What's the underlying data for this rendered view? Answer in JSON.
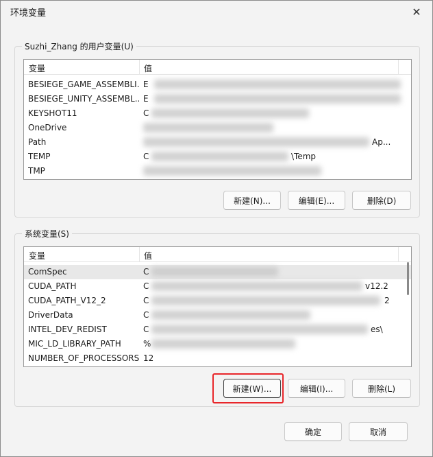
{
  "window": {
    "title": "环境变量",
    "close_symbol": "✕"
  },
  "user_section": {
    "legend": "Suzhi_Zhang 的用户变量(U)",
    "columns": {
      "name": "变量",
      "value": "值"
    },
    "rows": [
      {
        "name": "BESIEGE_GAME_ASSEMBLI...",
        "value_prefix": "E"
      },
      {
        "name": "BESIEGE_UNITY_ASSEMBL...",
        "value_prefix": "E"
      },
      {
        "name": "KEYSHOT11",
        "value_prefix": "C"
      },
      {
        "name": "OneDrive",
        "value_prefix": ""
      },
      {
        "name": "Path",
        "value_prefix": "",
        "value_suffix": "Ap..."
      },
      {
        "name": "TEMP",
        "value_prefix": "C",
        "value_suffix": "\\Temp"
      },
      {
        "name": "TMP",
        "value_prefix": ""
      }
    ],
    "buttons": {
      "new": "新建(N)...",
      "edit": "编辑(E)...",
      "delete": "删除(D)"
    }
  },
  "system_section": {
    "legend": "系统变量(S)",
    "columns": {
      "name": "变量",
      "value": "值"
    },
    "rows": [
      {
        "name": "ComSpec",
        "value_prefix": "C",
        "selected": true
      },
      {
        "name": "CUDA_PATH",
        "value_prefix": "C",
        "value_suffix": "v12.2"
      },
      {
        "name": "CUDA_PATH_V12_2",
        "value_prefix": "C",
        "value_suffix": "2"
      },
      {
        "name": "DriverData",
        "value_prefix": "C"
      },
      {
        "name": "INTEL_DEV_REDIST",
        "value_prefix": "C",
        "value_suffix": "es\\"
      },
      {
        "name": "MIC_LD_LIBRARY_PATH",
        "value_prefix": "%"
      },
      {
        "name": "NUMBER_OF_PROCESSORS",
        "value_prefix": "12"
      }
    ],
    "buttons": {
      "new": "新建(W)...",
      "edit": "编辑(I)...",
      "delete": "删除(L)"
    }
  },
  "footer": {
    "ok": "确定",
    "cancel": "取消"
  },
  "colors": {
    "highlight": "#e8262a",
    "selected_row": "#e8e8e8"
  }
}
